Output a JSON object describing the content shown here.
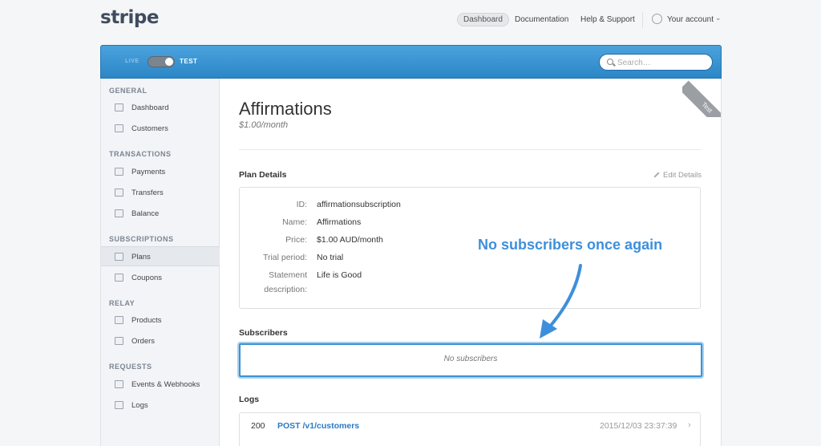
{
  "topnav": {
    "logo": "stripe",
    "dashboard": "Dashboard",
    "documentation": "Documentation",
    "help": "Help & Support",
    "account": "Your account"
  },
  "toolbar": {
    "live_label": "LIVE",
    "test_label": "TEST",
    "search_placeholder": "Search…"
  },
  "sidebar": {
    "sections": [
      {
        "header": "GENERAL",
        "items": [
          "Dashboard",
          "Customers"
        ]
      },
      {
        "header": "TRANSACTIONS",
        "items": [
          "Payments",
          "Transfers",
          "Balance"
        ]
      },
      {
        "header": "SUBSCRIPTIONS",
        "items": [
          "Plans",
          "Coupons"
        ]
      },
      {
        "header": "RELAY",
        "items": [
          "Products",
          "Orders"
        ]
      },
      {
        "header": "REQUESTS",
        "items": [
          "Events & Webhooks",
          "Logs"
        ]
      }
    ],
    "active_item": "Plans"
  },
  "main": {
    "ribbon": "Test",
    "title": "Affirmations",
    "subtitle": "$1.00/month",
    "plan_details_heading": "Plan Details",
    "edit_label": "Edit Details",
    "details": [
      {
        "label": "ID:",
        "value": "affirmationsubscription"
      },
      {
        "label": "Name:",
        "value": "Affirmations"
      },
      {
        "label": "Price:",
        "value": "$1.00 AUD/month"
      },
      {
        "label": "Trial period:",
        "value": "No trial"
      },
      {
        "label": "Statement",
        "label2": "description:",
        "value": "Life is Good"
      }
    ],
    "annotation": "No subscribers once again",
    "subscribers_heading": "Subscribers",
    "subscribers_empty": "No subscribers",
    "logs_heading": "Logs",
    "logs": [
      {
        "status": "200",
        "path": "POST /v1/customers",
        "time": "2015/12/03 23:37:39"
      }
    ]
  },
  "colors": {
    "accent": "#2c86c6",
    "link": "#2b7ac4",
    "annotation": "#3d8fdc"
  }
}
